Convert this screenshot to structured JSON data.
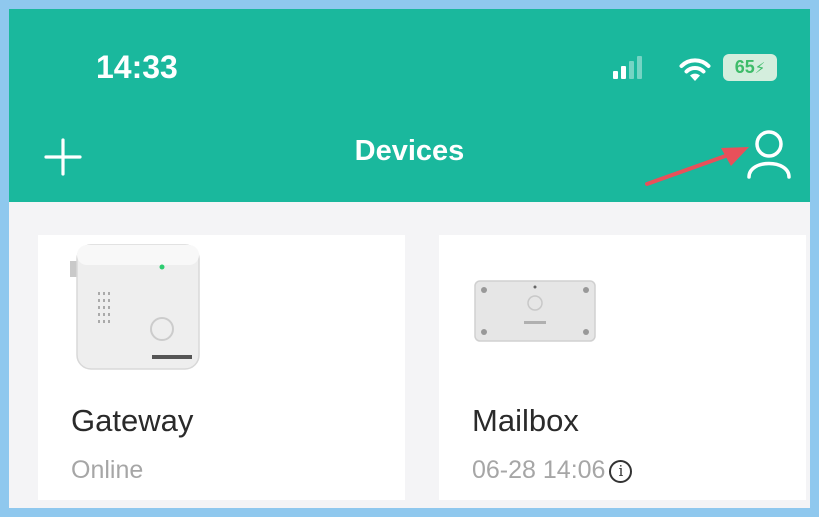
{
  "status_bar": {
    "time": "14:33",
    "battery_level": "65",
    "signal_icon": "signal-bars-icon",
    "wifi_icon": "wifi-icon",
    "charging_icon": "lightning-icon"
  },
  "header": {
    "title": "Devices",
    "add_icon": "plus-icon",
    "profile_icon": "user-icon",
    "annotation": "red arrow pointing to profile icon",
    "background_color": "#1ab89d"
  },
  "devices": [
    {
      "name": "Gateway",
      "status": "Online",
      "image_icon": "gateway-device-image"
    },
    {
      "name": "Mailbox",
      "status": "06-28 14:06",
      "image_icon": "mailbox-sensor-image",
      "has_info_icon": true
    }
  ],
  "colors": {
    "accent": "#1ab89d",
    "page_background": "#f4f4f6",
    "card": "#ffffff",
    "status_text": "#a6a6a6",
    "battery_green": "#3fbc6a"
  }
}
